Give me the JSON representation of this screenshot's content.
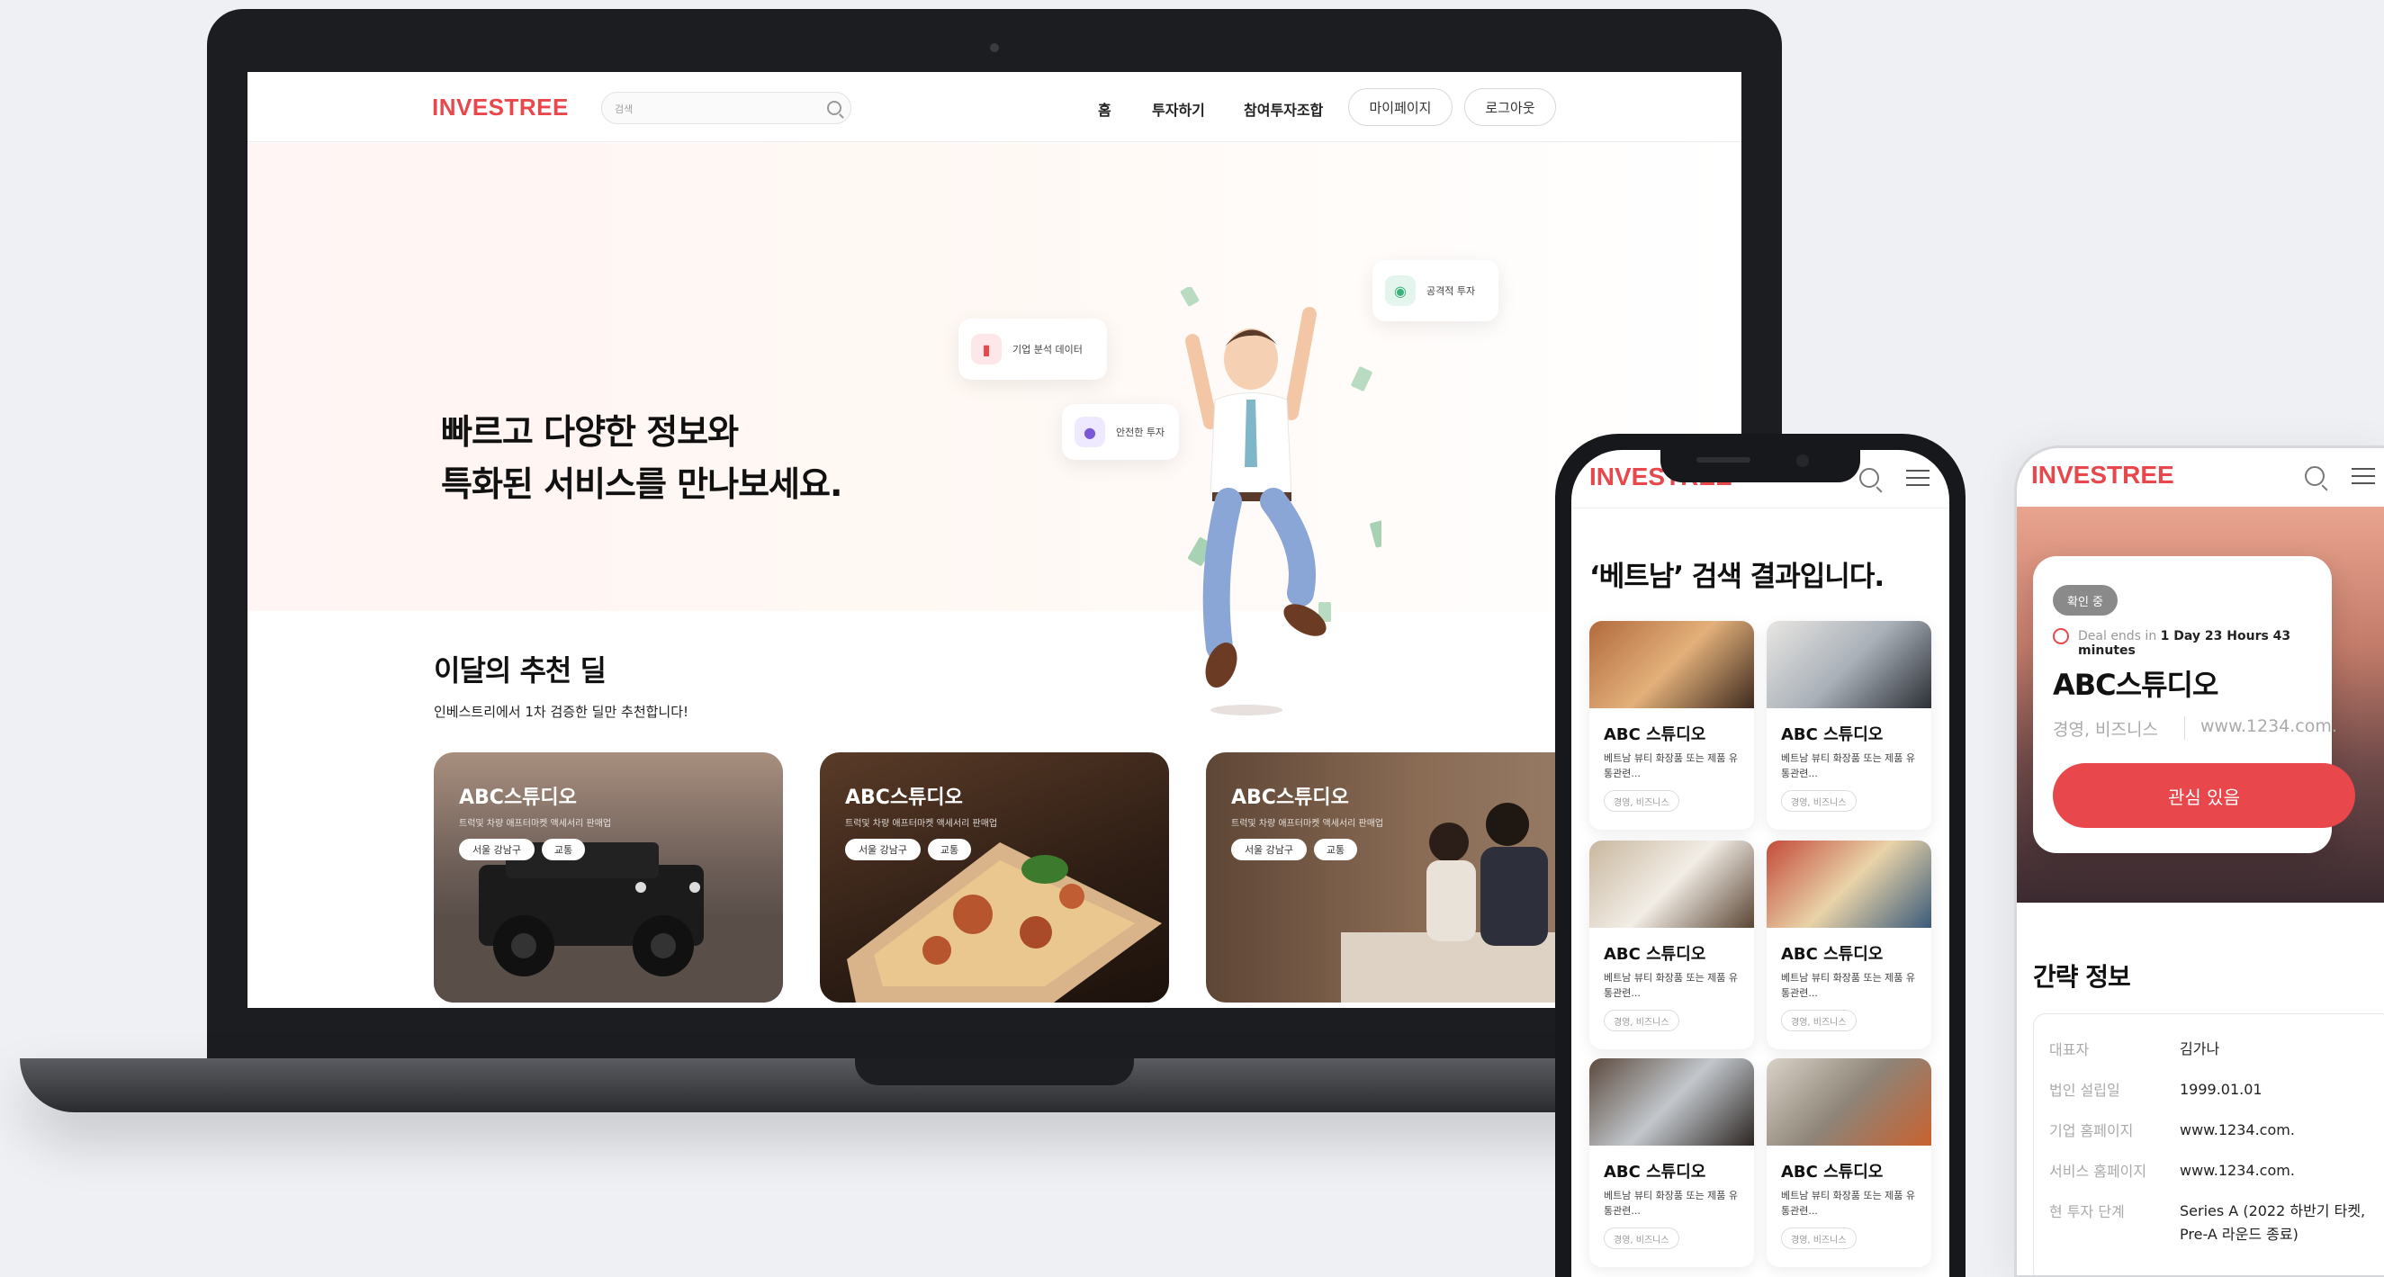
{
  "laptop": {
    "header": {
      "logo": "INVESTREE",
      "search_placeholder": "검색",
      "nav": [
        "홈",
        "투자하기",
        "참여투자조합"
      ],
      "mypage": "마이페이지",
      "logout": "로그아웃"
    },
    "hero": {
      "title_line1": "빠르고 다양한 정보와",
      "title_line2": "특화된 서비스를 만나보세요.",
      "float_cards": [
        "기업 분석 데이터",
        "안전한 투자",
        "공격적 투자"
      ]
    },
    "recommended": {
      "title": "이달의 추천 딜",
      "subtitle": "인베스트리에서 1차 검증한 딜만 추천합니다!",
      "deals": [
        {
          "title": "ABC스튜디오",
          "desc": "트럭및 차량 애프터마켓 액세서리 판매업",
          "tags": [
            "서울 강남구",
            "교통"
          ]
        },
        {
          "title": "ABC스튜디오",
          "desc": "트럭및 차량 애프터마켓 액세서리 판매업",
          "tags": [
            "서울 강남구",
            "교통"
          ]
        },
        {
          "title": "ABC스튜디오",
          "desc": "트럭및 차량 애프터마켓 액세서리 판매업",
          "tags": [
            "서울 강남구",
            "교통"
          ]
        }
      ]
    }
  },
  "phone1": {
    "logo": "INVESTREE",
    "heading": "‘베트남’ 검색 결과입니다.",
    "results": [
      {
        "title": "ABC 스튜디오",
        "desc": "베트남 뷰티 화장품 또는 제품 유통관련...",
        "tag": "경영, 비즈니스"
      },
      {
        "title": "ABC 스튜디오",
        "desc": "베트남 뷰티 화장품 또는 제품 유통관련...",
        "tag": "경영, 비즈니스"
      },
      {
        "title": "ABC 스튜디오",
        "desc": "베트남 뷰티 화장품 또는 제품 유통관련...",
        "tag": "경영, 비즈니스"
      },
      {
        "title": "ABC 스튜디오",
        "desc": "베트남 뷰티 화장품 또는 제품 유통관련...",
        "tag": "경영, 비즈니스"
      },
      {
        "title": "ABC 스튜디오",
        "desc": "베트남 뷰티 화장품 또는 제품 유통관련...",
        "tag": "경영, 비즈니스"
      },
      {
        "title": "ABC 스튜디오",
        "desc": "베트남 뷰티 화장품 또는 제품 유통관련...",
        "tag": "경영, 비즈니스"
      }
    ]
  },
  "phone2": {
    "logo": "INVESTREE",
    "badge": "확인 중",
    "deal_prefix": "Deal ends in",
    "deal_time": "1 Day 23 Hours 43 minutes",
    "company": "ABC스튜디오",
    "category": "경영, 비즈니스",
    "website": "www.1234.com.",
    "interest_button": "관심 있음",
    "section_title": "간략 정보",
    "info": [
      {
        "key": "대표자",
        "value": "김가나"
      },
      {
        "key": "법인 설립일",
        "value": "1999.01.01"
      },
      {
        "key": "기업 홈페이지",
        "value": "www.1234.com."
      },
      {
        "key": "서비스 홈페이지",
        "value": "www.1234.com."
      },
      {
        "key": "현 투자 단계",
        "value": "Series A (2022 하반기 타켓, Pre-A 라운드 종료)"
      }
    ]
  },
  "colors": {
    "brand": "#e8474c",
    "background": "#eef0f4"
  }
}
